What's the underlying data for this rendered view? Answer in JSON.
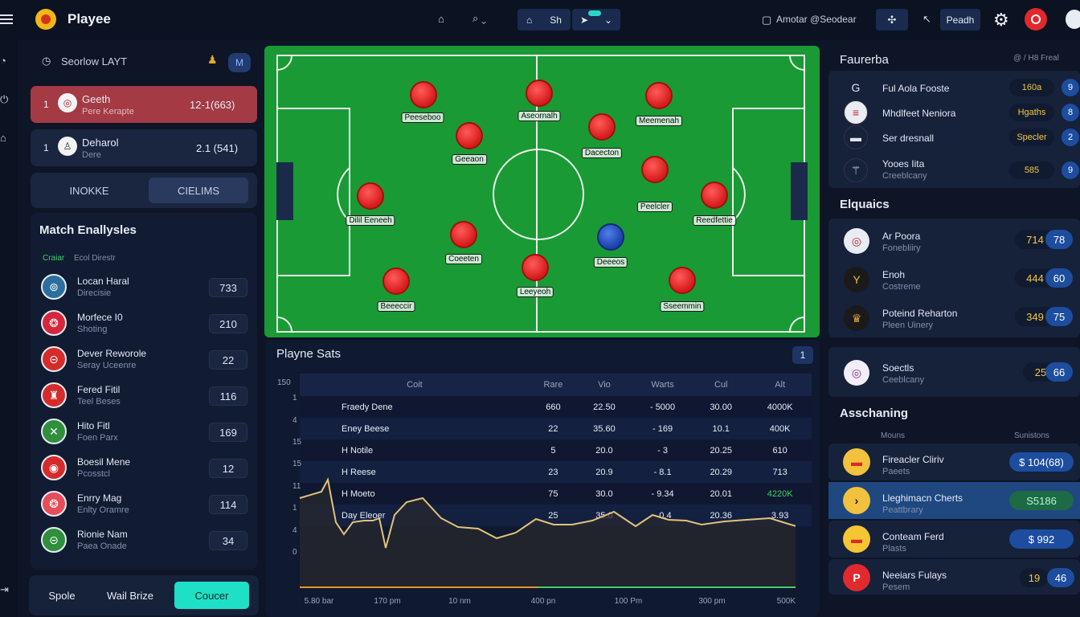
{
  "app": {
    "title": "Playee"
  },
  "topbar": {
    "home_label": "Sh",
    "badge": "",
    "user_label": "Amotar @Seodear",
    "search_label": "Peadh"
  },
  "left": {
    "section_label": "Seorlow LAYT",
    "matches": [
      {
        "num": "1",
        "name": "Geeth",
        "sub": "Pere Kerapte",
        "score": "12-1(663)"
      },
      {
        "num": "1",
        "name": "Deharol",
        "sub": "Dere",
        "score": "2.1 (541)"
      }
    ],
    "tabs": [
      "INOKKE",
      "CIELIMS"
    ],
    "analysis_title": "Match Enallysles",
    "analysis_sub_a": "Craiar",
    "analysis_sub_b": "Ecol Direstr",
    "players": [
      {
        "name": "Locan Haral",
        "sub": "Direcisie",
        "value": "733",
        "color": "#2b6f9e"
      },
      {
        "name": "Morfece I0",
        "sub": "Shoting",
        "value": "210",
        "color": "#d6263b"
      },
      {
        "name": "Dever Reworole",
        "sub": "Seray Uceenre",
        "value": "22",
        "color": "#d62b2b"
      },
      {
        "name": "Fered Fitil",
        "sub": "Teel Beses",
        "value": "116",
        "color": "#d62b2b"
      },
      {
        "name": "Hito Fitl",
        "sub": "Foen Parx",
        "value": "169",
        "color": "#2f8f3c"
      },
      {
        "name": "Boesil Mene",
        "sub": "Pcosstcl",
        "value": "12",
        "color": "#d62b2b"
      },
      {
        "name": "Enrry Mag",
        "sub": "Enlty Oramre",
        "value": "114",
        "color": "#e64d5a"
      },
      {
        "name": "Rionie Nam",
        "sub": "Paea Onade",
        "value": "34",
        "color": "#2f8f3c"
      }
    ],
    "footer": [
      "Spole",
      "Wail Brize",
      "Coucer"
    ]
  },
  "pitch": {
    "players": [
      {
        "label": "Peeseboo",
        "team": "red"
      },
      {
        "label": "Aseornalh",
        "team": "red"
      },
      {
        "label": "Meemenah",
        "team": "red"
      },
      {
        "label": "Geeaon",
        "team": "red"
      },
      {
        "label": "Dacecton",
        "team": "red"
      },
      {
        "label": "Dilil Eeneeh",
        "team": "red"
      },
      {
        "label": "Peelcler",
        "team": "red"
      },
      {
        "label": "Reedfettie",
        "team": "red"
      },
      {
        "label": "Coeeten",
        "team": "red"
      },
      {
        "label": "Deeeos",
        "team": "blue"
      },
      {
        "label": "Beeeccir",
        "team": "red"
      },
      {
        "label": "Leeyeoh",
        "team": "red"
      },
      {
        "label": "Sseemmin",
        "team": "red"
      }
    ]
  },
  "stats": {
    "title": "Playne Sats",
    "page": "1",
    "columns": [
      "Coit",
      "Rare",
      "Vio",
      "Warts",
      "Cul",
      "Alt"
    ],
    "rows": [
      [
        "Fraedy Dene",
        "660",
        "22.50",
        "- 5000",
        "30.00",
        "4000K"
      ],
      [
        "Eney Beese",
        "22",
        "35.60",
        "- 169",
        "10.1",
        "400K"
      ],
      [
        "H Notile",
        "5",
        "20.0",
        "- 3",
        "20.25",
        "610"
      ],
      [
        "H Reese",
        "23",
        "20.9",
        "- 8.1",
        "20.29",
        "713"
      ],
      [
        "H Moeto",
        "75",
        "30.0",
        "- 9.34",
        "20.01",
        "4220K"
      ],
      [
        "Day Eleoer",
        "25",
        "35.0",
        "- 0.4",
        "20.36",
        "3.93"
      ]
    ],
    "yticks": [
      "150",
      "1",
      "4",
      "15",
      "15",
      "11",
      "1",
      "4",
      "0"
    ],
    "xticks": [
      "5.80 bar",
      "170 pm",
      "10 nm",
      "400 pn",
      "100 Pm",
      "300 pm",
      "500K"
    ],
    "colors": {
      "line": "#e2c27a",
      "accent_green": "#3fd06a"
    }
  },
  "right": {
    "favorites_title": "Faurerba",
    "favorites_meta": "@ / H8 Freal",
    "favorites": [
      {
        "name": "Ful Aola Fooste",
        "sub": "",
        "tag": "160a",
        "count": "9"
      },
      {
        "name": "Mhdlfeet Neniora",
        "sub": "",
        "tag": "Hgaths",
        "count": "8"
      },
      {
        "name": "Ser dresnall",
        "sub": "",
        "tag": "Specler",
        "count": "2"
      },
      {
        "name": "Yooes Iita",
        "sub": "Creeblcany",
        "tag": "585",
        "count": "9"
      }
    ],
    "equalis_title": "Elquaics",
    "equalis": [
      {
        "name": "Ar Poora",
        "sub": "Fonebliiry",
        "a": "714",
        "b": "78"
      },
      {
        "name": "Enoh",
        "sub": "Costreme",
        "a": "444",
        "b": "60"
      },
      {
        "name": "Poteind Reharton",
        "sub": "Pleen Uinery",
        "a": "349",
        "b": "75"
      }
    ],
    "social": {
      "name": "Soectls",
      "sub": "Ceeblcany",
      "a": "25",
      "b": "66"
    },
    "asch_title": "Asschaning",
    "asch_cols": [
      "Mouns",
      "Sunistons"
    ],
    "asch": [
      {
        "name": "Fireacler Cliriv",
        "sub": "Paeets",
        "price": "$ 104(68)"
      },
      {
        "name": "Lleghimacn Cherts",
        "sub": "Peattbrary",
        "price": "S5186"
      },
      {
        "name": "Conteam Ferd",
        "sub": "Plasts",
        "price": "$ 992"
      },
      {
        "name": "Neeiars Fulays",
        "sub": "Pesem",
        "price": "46",
        "pre": "19"
      }
    ]
  }
}
